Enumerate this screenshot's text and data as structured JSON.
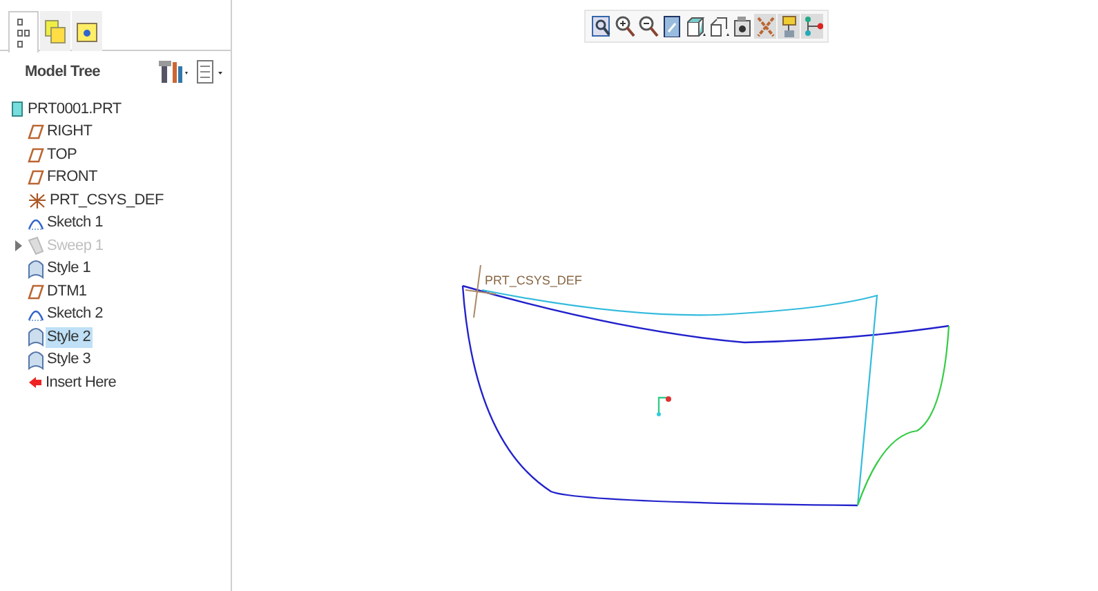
{
  "nav_tabs": [
    {
      "selected": true
    },
    {
      "selected": false
    },
    {
      "selected": false
    }
  ],
  "model_tree": {
    "title": "Model Tree",
    "items": [
      {
        "label": "PRT0001.PRT",
        "kind": "part",
        "selected": false,
        "disabled": false
      },
      {
        "label": "RIGHT",
        "kind": "plane",
        "selected": false,
        "disabled": false
      },
      {
        "label": "TOP",
        "kind": "plane",
        "selected": false,
        "disabled": false
      },
      {
        "label": "FRONT",
        "kind": "plane",
        "selected": false,
        "disabled": false
      },
      {
        "label": "PRT_CSYS_DEF",
        "kind": "csys",
        "selected": false,
        "disabled": false
      },
      {
        "label": "Sketch 1",
        "kind": "sketch",
        "selected": false,
        "disabled": false
      },
      {
        "label": "Sweep 1",
        "kind": "sweep",
        "selected": false,
        "disabled": true,
        "expanded": false
      },
      {
        "label": "Style 1",
        "kind": "style",
        "selected": false,
        "disabled": false
      },
      {
        "label": "DTM1",
        "kind": "plane",
        "selected": false,
        "disabled": false
      },
      {
        "label": "Sketch 2",
        "kind": "sketch",
        "selected": false,
        "disabled": false
      },
      {
        "label": "Style 2",
        "kind": "style",
        "selected": true,
        "disabled": false
      },
      {
        "label": "Style 3",
        "kind": "style",
        "selected": false,
        "disabled": false
      },
      {
        "label": "Insert Here",
        "kind": "insert",
        "selected": false,
        "disabled": false
      }
    ]
  },
  "toolbar": [
    {
      "kind": "refit",
      "pressed": false
    },
    {
      "kind": "zoom-in",
      "pressed": false
    },
    {
      "kind": "zoom-out",
      "pressed": false
    },
    {
      "kind": "repaint",
      "pressed": false
    },
    {
      "kind": "display",
      "pressed": false
    },
    {
      "kind": "views",
      "pressed": false
    },
    {
      "kind": "camera",
      "pressed": false
    },
    {
      "kind": "planes",
      "pressed": true
    },
    {
      "kind": "axes",
      "pressed": true
    },
    {
      "kind": "network",
      "pressed": true
    }
  ],
  "canvas": {
    "csys_label": "PRT_CSYS_DEF"
  }
}
